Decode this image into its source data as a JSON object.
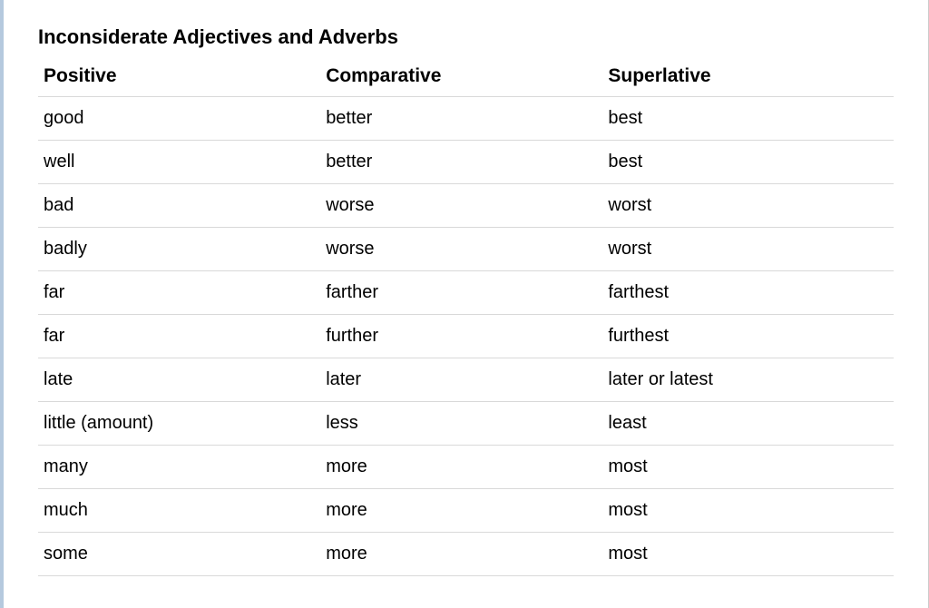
{
  "title": "Inconsiderate Adjectives and Adverbs",
  "headers": {
    "col1": "Positive",
    "col2": "Comparative",
    "col3": "Superlative"
  },
  "chart_data": {
    "type": "table",
    "title": "Inconsiderate Adjectives and Adverbs",
    "columns": [
      "Positive",
      "Comparative",
      "Superlative"
    ],
    "rows": [
      [
        "good",
        "better",
        "best"
      ],
      [
        "well",
        "better",
        "best"
      ],
      [
        "bad",
        "worse",
        "worst"
      ],
      [
        "badly",
        "worse",
        "worst"
      ],
      [
        "far",
        "farther",
        "farthest"
      ],
      [
        "far",
        "further",
        "furthest"
      ],
      [
        "late",
        "later",
        "later or latest"
      ],
      [
        "little (amount)",
        "less",
        "least"
      ],
      [
        "many",
        "more",
        "most"
      ],
      [
        "much",
        "more",
        "most"
      ],
      [
        "some",
        "more",
        "most"
      ]
    ]
  }
}
